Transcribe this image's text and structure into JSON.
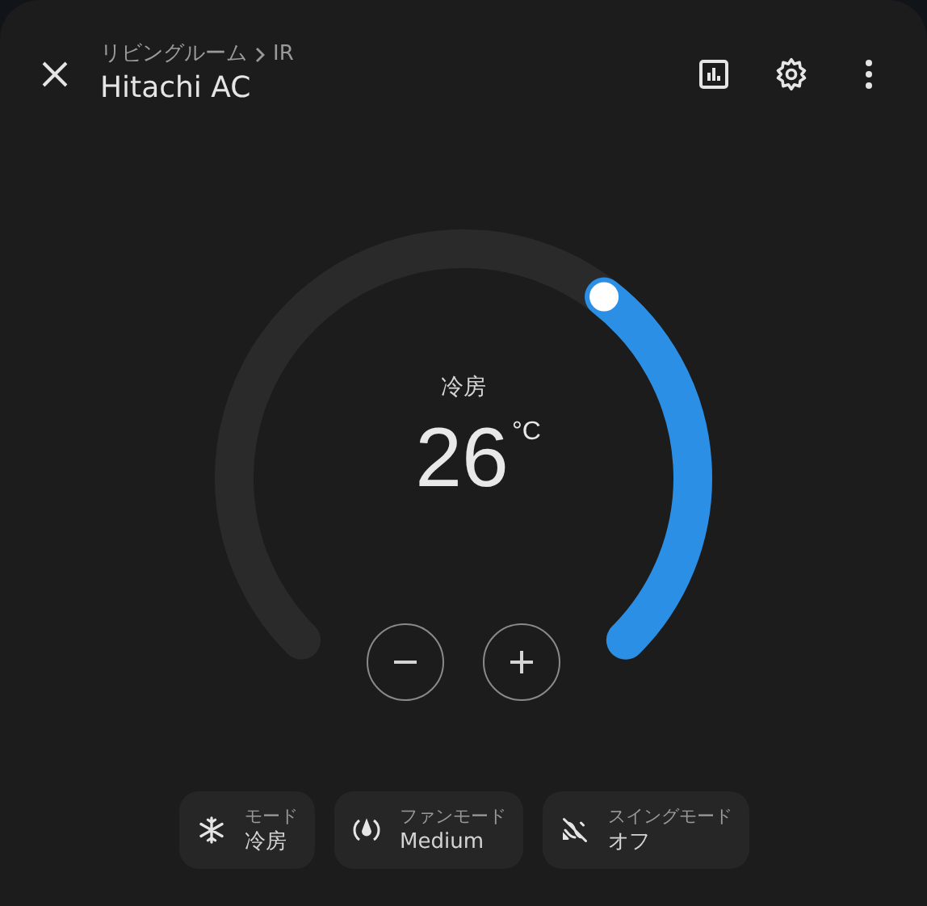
{
  "header": {
    "breadcrumb": "リビングルーム",
    "breadcrumb_sub": "IR",
    "title": "Hitachi AC"
  },
  "dial": {
    "mode": "冷房",
    "temperature": "26",
    "unit": "°C"
  },
  "controls": [
    {
      "kind": "minus"
    },
    {
      "kind": "plus"
    }
  ],
  "chips": [
    {
      "kind": "mode",
      "label": "モード",
      "value": "冷房"
    },
    {
      "kind": "fan",
      "label": "ファンモード",
      "value": "Medium"
    },
    {
      "kind": "swing",
      "label": "スイングモード",
      "value": "オフ"
    }
  ]
}
